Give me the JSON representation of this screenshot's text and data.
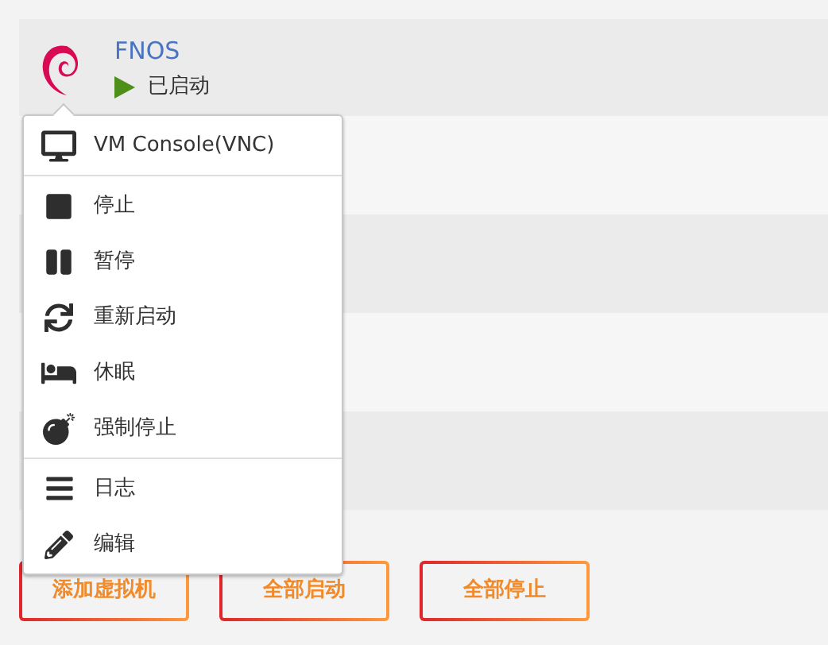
{
  "vms": [
    {
      "name": "FNOS",
      "status": "已启动",
      "running": true
    }
  ],
  "menu": {
    "groups": [
      [
        {
          "kind": "console",
          "label": "VM Console(VNC)"
        }
      ],
      [
        {
          "kind": "stop",
          "label": "停止"
        },
        {
          "kind": "pause",
          "label": "暂停"
        },
        {
          "kind": "restart",
          "label": "重新启动"
        },
        {
          "kind": "sleep",
          "label": "休眠"
        },
        {
          "kind": "kill",
          "label": "强制停止"
        }
      ],
      [
        {
          "kind": "log",
          "label": "日志"
        },
        {
          "kind": "edit",
          "label": "编辑"
        }
      ]
    ]
  },
  "buttons": [
    "添加虚拟机",
    "全部启动",
    "全部停止"
  ]
}
